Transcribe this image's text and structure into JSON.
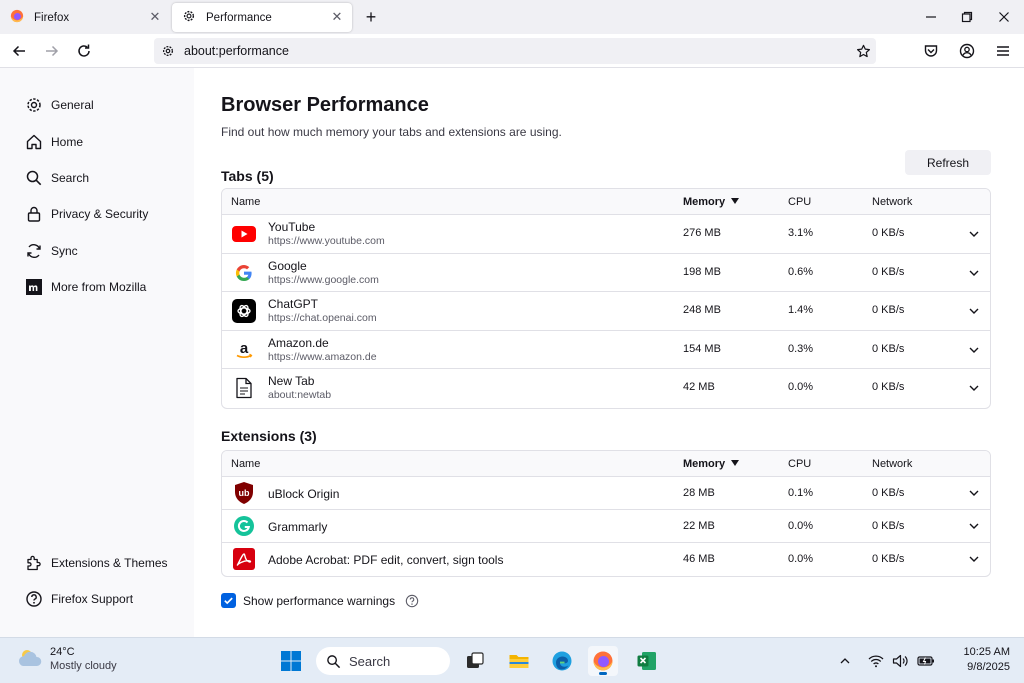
{
  "tabs": [
    {
      "title": "Firefox",
      "active": false
    },
    {
      "title": "Performance",
      "active": true
    }
  ],
  "toolbar": {
    "url": "about:performance"
  },
  "sidebar": {
    "items": [
      {
        "label": "General",
        "icon": "gear-icon"
      },
      {
        "label": "Home",
        "icon": "home-icon"
      },
      {
        "label": "Search",
        "icon": "search-icon"
      },
      {
        "label": "Privacy & Security",
        "icon": "lock-icon"
      },
      {
        "label": "Sync",
        "icon": "sync-icon"
      },
      {
        "label": "More from Mozilla",
        "icon": "mozilla-icon"
      }
    ],
    "footer": [
      {
        "label": "Extensions & Themes",
        "icon": "puzzle-icon"
      },
      {
        "label": "Firefox Support",
        "icon": "help-icon"
      }
    ]
  },
  "main": {
    "title": "Browser Performance",
    "subtitle": "Find out how much memory your tabs and extensions are using.",
    "refresh_label": "Refresh",
    "columns": {
      "name": "Name",
      "memory": "Memory",
      "cpu": "CPU",
      "network": "Network"
    },
    "tabs_heading": "Tabs (5)",
    "tabs_rows": [
      {
        "name": "YouTube",
        "url": "https://www.youtube.com",
        "memory": "276 MB",
        "cpu": "3.1%",
        "network": "0 KB/s",
        "icon": "youtube-icon"
      },
      {
        "name": "Google",
        "url": "https://www.google.com",
        "memory": "198 MB",
        "cpu": "0.6%",
        "network": "0 KB/s",
        "icon": "google-icon"
      },
      {
        "name": "ChatGPT",
        "url": "https://chat.openai.com",
        "memory": "248 MB",
        "cpu": "1.4%",
        "network": "0 KB/s",
        "icon": "chatgpt-icon"
      },
      {
        "name": "Amazon.de",
        "url": "https://www.amazon.de",
        "memory": "154 MB",
        "cpu": "0.3%",
        "network": "0 KB/s",
        "icon": "amazon-icon"
      },
      {
        "name": "New Tab",
        "url": "about:newtab",
        "memory": "42 MB",
        "cpu": "0.0%",
        "network": "0 KB/s",
        "icon": "document-icon"
      }
    ],
    "extensions_heading": "Extensions (3)",
    "extension_rows": [
      {
        "name": "uBlock Origin",
        "memory": "28 MB",
        "cpu": "0.1%",
        "network": "0 KB/s",
        "icon": "ublock-icon"
      },
      {
        "name": "Grammarly",
        "memory": "22 MB",
        "cpu": "0.0%",
        "network": "0 KB/s",
        "icon": "grammarly-icon"
      },
      {
        "name": "Adobe Acrobat: PDF edit, convert, sign tools",
        "memory": "46 MB",
        "cpu": "0.0%",
        "network": "0 KB/s",
        "icon": "acrobat-icon"
      }
    ],
    "warnings_label": "Show performance warnings",
    "warnings_checked": true
  },
  "taskbar": {
    "weather_temp": "24°C",
    "weather_condition": "Mostly cloudy",
    "search_label": "Search",
    "time": "10:25 AM",
    "date": "9/8/2025"
  },
  "colors": {
    "accent": "#0061e0",
    "youtube": "#ff0000",
    "grammarly": "#15c39a",
    "acrobat": "#d7000f",
    "ublock": "#800000"
  }
}
